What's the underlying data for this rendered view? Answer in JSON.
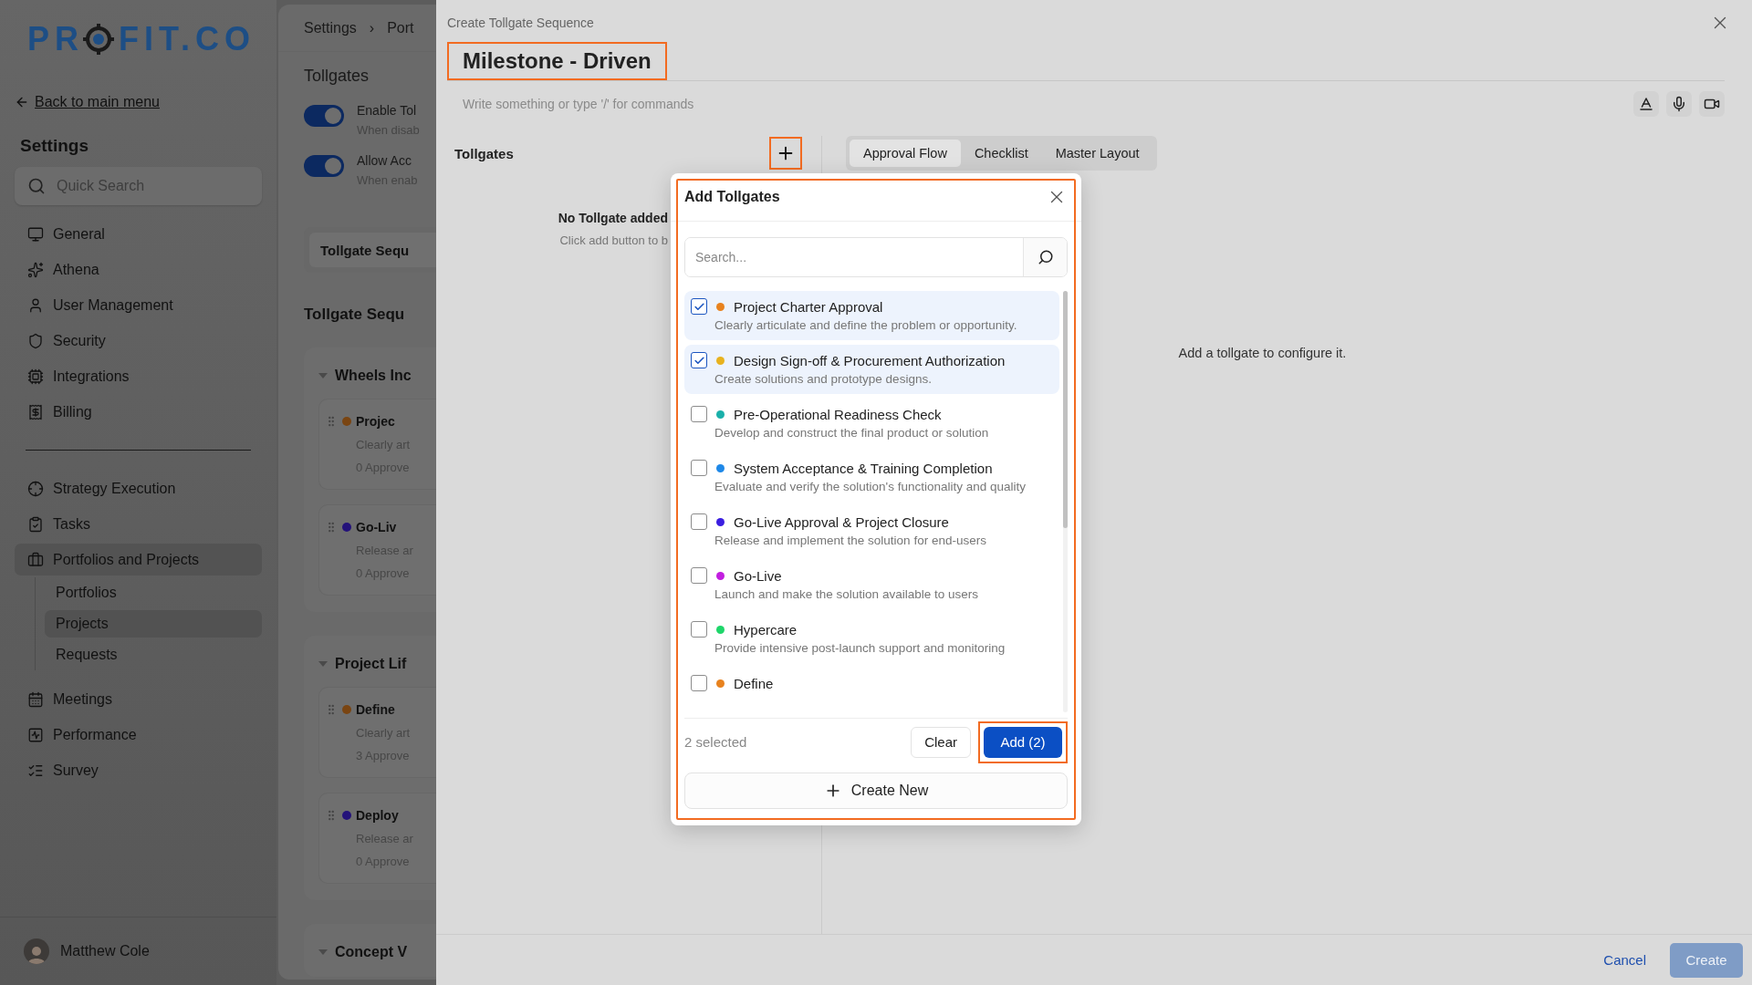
{
  "sidebar": {
    "logo": {
      "before": "PR",
      "after": "FIT.CO"
    },
    "back_link": "Back to main menu",
    "title": "Settings",
    "search": {
      "placeholder": "Quick Search"
    },
    "sections": [
      {
        "items": [
          {
            "label": "General",
            "selected": false
          },
          {
            "label": "Athena",
            "selected": false
          },
          {
            "label": "User Management",
            "selected": false
          },
          {
            "label": "Security",
            "selected": false
          },
          {
            "label": "Integrations",
            "selected": false
          },
          {
            "label": "Billing",
            "selected": false
          }
        ]
      },
      {
        "items": [
          {
            "label": "Strategy Execution",
            "selected": false
          },
          {
            "label": "Tasks",
            "selected": false
          },
          {
            "label": "Portfolios and Projects",
            "selected": true,
            "children": [
              {
                "label": "Portfolios",
                "selected": false
              },
              {
                "label": "Projects",
                "selected": true
              },
              {
                "label": "Requests",
                "selected": false
              }
            ]
          },
          {
            "label": "Meetings",
            "selected": false
          },
          {
            "label": "Performance",
            "selected": false
          },
          {
            "label": "Survey",
            "selected": false
          }
        ]
      }
    ],
    "user": {
      "name": "Matthew Cole"
    }
  },
  "background_page": {
    "breadcrumb": {
      "items": [
        "Settings",
        "Port"
      ],
      "separator": "›"
    },
    "title": "Tollgates",
    "toggles": [
      {
        "label": "Enable Tol",
        "hint": "When disab",
        "on": true
      },
      {
        "label": "Allow Acc",
        "hint": "When enab",
        "on": true
      }
    ],
    "sequence_button": "Tollgate Sequ",
    "section_title": "Tollgate Sequ",
    "groups": [
      {
        "name": "Wheels Inc",
        "expanded": true,
        "items": [
          {
            "name": "Projec",
            "color": "#7a4512",
            "description": "Clearly art",
            "approvers": "0 Approve"
          },
          {
            "name": "Go-Liv",
            "color": "#24127a",
            "description": "Release ar",
            "approvers": "0 Approve"
          }
        ]
      },
      {
        "name": "Project Lif",
        "expanded": true,
        "items": [
          {
            "name": "Define",
            "color": "#7a4512",
            "description": "Clearly art",
            "approvers": "3 Approve"
          },
          {
            "name": "Deploy",
            "color": "#24127a",
            "description": "Release ar",
            "approvers": "0 Approve"
          }
        ]
      },
      {
        "name": "Concept V",
        "expanded": true
      }
    ]
  },
  "drawer": {
    "subtitle": "Create Tollgate Sequence",
    "title": "Milestone - Driven",
    "title_highlighted": true,
    "editor": {
      "placeholder": "Write something or type '/' for commands"
    },
    "tollgates": {
      "label": "Tollgates",
      "add_highlighted": true,
      "empty_title": "No Tollgate added",
      "empty_hint": "Click add button to b"
    },
    "tabs": [
      {
        "label": "Approval Flow",
        "selected": true
      },
      {
        "label": "Checklist",
        "selected": false
      },
      {
        "label": "Master Layout",
        "selected": false
      }
    ],
    "config_empty": "Add a tollgate to configure it.",
    "cancel": "Cancel",
    "create": "Create"
  },
  "dialog": {
    "title": "Add Tollgates",
    "highlighted": true,
    "search": {
      "placeholder": "Search..."
    },
    "items": [
      {
        "name": "Project Charter Approval",
        "description": "Clearly articulate and define the problem or opportunity.",
        "color": "#e8821e",
        "checked": true
      },
      {
        "name": "Design Sign-off & Procurement Authorization",
        "description": "Create solutions and prototype designs.",
        "color": "#e8b21e",
        "checked": true
      },
      {
        "name": "Pre-Operational Readiness Check",
        "description": "Develop and construct the final product or solution",
        "color": "#1ab0aa",
        "checked": false
      },
      {
        "name": "System Acceptance & Training Completion",
        "description": "Evaluate and verify the solution's functionality and quality",
        "color": "#1e88e8",
        "checked": false
      },
      {
        "name": "Go-Live Approval & Project Closure",
        "description": "Release and implement the solution for end-users",
        "color": "#3b1ee0",
        "checked": false
      },
      {
        "name": "Go-Live",
        "description": "Launch and make the solution available to users",
        "color": "#c21ee0",
        "checked": false
      },
      {
        "name": "Hypercare",
        "description": "Provide intensive post-launch support and monitoring",
        "color": "#1ed66a",
        "checked": false
      },
      {
        "name": "Define",
        "color": "#e8821e",
        "checked": false
      }
    ],
    "selected_count": "2 selected",
    "clear": "Clear",
    "add": "Add (2)",
    "add_highlighted": true,
    "create_new": "Create New"
  }
}
